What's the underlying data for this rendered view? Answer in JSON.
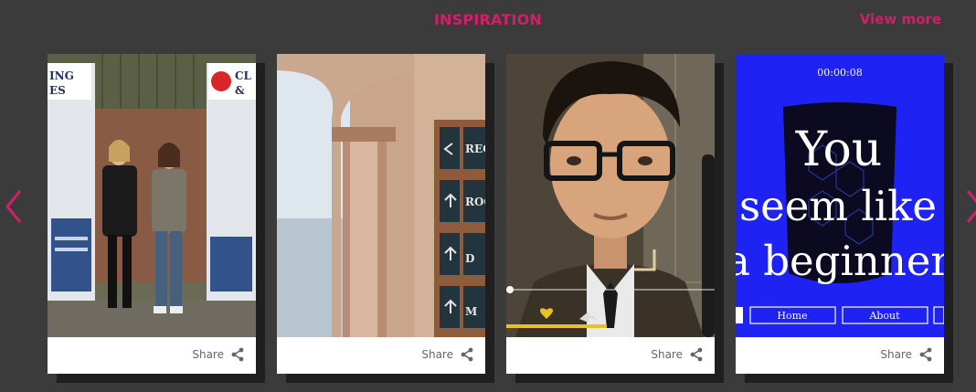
{
  "header": {
    "title": "INSPIRATION",
    "view_more": "View more"
  },
  "colors": {
    "accent": "#d11f6b",
    "background": "#3b3b3b"
  },
  "cards": [
    {
      "share_label": "Share",
      "sign_left": "ING\nES",
      "sign_right": "CL\n&"
    },
    {
      "share_label": "Share",
      "signs": [
        "REC",
        "ROO",
        "D",
        "M"
      ]
    },
    {
      "share_label": "Share"
    },
    {
      "share_label": "Share",
      "timer": "00:00:08",
      "headline": [
        "You",
        "seem like",
        "a beginner"
      ],
      "nav": [
        "Home",
        "About"
      ]
    }
  ],
  "icons": {
    "prev": "chevron-left-icon",
    "next": "chevron-right-icon",
    "share": "share-icon"
  }
}
